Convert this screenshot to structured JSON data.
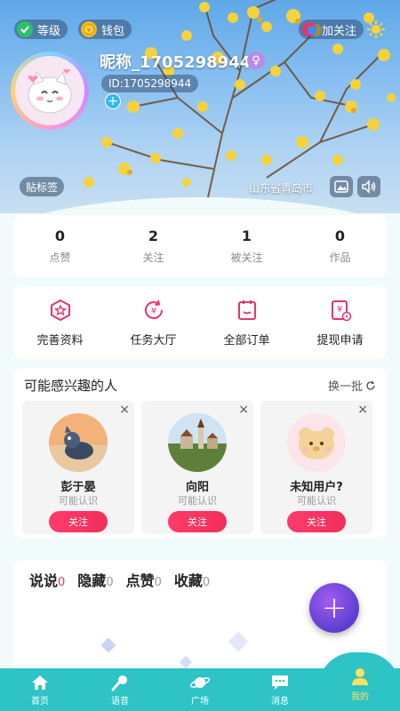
{
  "header": {
    "level_label": "等级",
    "wallet_label": "钱包",
    "follow_label": "加关注",
    "nickname": "昵称_1705298944",
    "gender_symbol": "♀",
    "user_id": "ID:1705298944",
    "add_tag_symbol": "+",
    "sticker_label": "贴标签",
    "location": "山东省青岛市"
  },
  "stats": [
    {
      "value": "0",
      "label": "点赞"
    },
    {
      "value": "2",
      "label": "关注"
    },
    {
      "value": "1",
      "label": "被关注"
    },
    {
      "value": "0",
      "label": "作品"
    }
  ],
  "actions": [
    {
      "label": "完善资料",
      "icon": "profile-star-icon"
    },
    {
      "label": "任务大厅",
      "icon": "yuan-cycle-icon"
    },
    {
      "label": "全部订单",
      "icon": "order-list-icon"
    },
    {
      "label": "提现申请",
      "icon": "withdraw-icon"
    }
  ],
  "recommend": {
    "title": "可能感兴趣的人",
    "refresh_label": "换一批",
    "people": [
      {
        "name": "彭于晏",
        "subtitle": "可能认识",
        "button": "关注",
        "close": "×"
      },
      {
        "name": "向阳",
        "subtitle": "可能认识",
        "button": "关注",
        "close": "×"
      },
      {
        "name": "未知用户?",
        "subtitle": "可能认识",
        "button": "关注",
        "close": "×"
      }
    ]
  },
  "feed": {
    "tabs": [
      {
        "label": "说说",
        "count": "0"
      },
      {
        "label": "隐藏",
        "count": "0"
      },
      {
        "label": "点赞",
        "count": "0"
      },
      {
        "label": "收藏",
        "count": "0"
      }
    ],
    "fab_symbol": "+"
  },
  "nav": [
    {
      "label": "首页",
      "icon": "home-icon"
    },
    {
      "label": "语音",
      "icon": "microphone-icon"
    },
    {
      "label": "广场",
      "icon": "planet-icon"
    },
    {
      "label": "消息",
      "icon": "chat-icon"
    },
    {
      "label": "我的",
      "icon": "user-icon"
    }
  ],
  "colors": {
    "accent_pink": "#f22e5b",
    "nav_teal": "#2ec3c5",
    "nav_active": "#ffe05a",
    "fab_purple": "#6a44d8"
  }
}
